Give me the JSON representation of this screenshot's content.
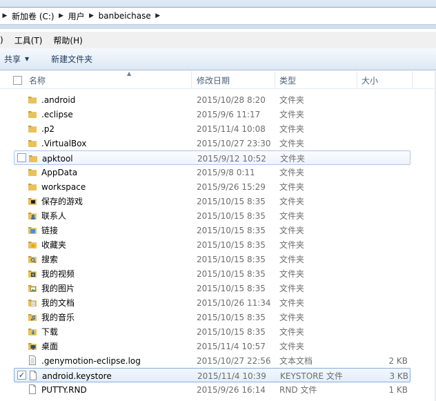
{
  "breadcrumb": {
    "items": [
      "新加卷 (C:)",
      "用户",
      "banbeichase"
    ]
  },
  "menubar": {
    "items": [
      {
        "label": ")",
        "name": "menu-view-partial"
      },
      {
        "label": "工具(T)",
        "name": "menu-tools"
      },
      {
        "label": "帮助(H)",
        "name": "menu-help"
      }
    ]
  },
  "toolbar": {
    "share_label": "共享",
    "new_folder_label": "新建文件夹"
  },
  "columns": {
    "name": "名称",
    "date": "修改日期",
    "type": "类型",
    "size": "大小"
  },
  "files": [
    {
      "name": ".android",
      "date": "2015/10/28 8:20",
      "type": "文件夹",
      "size": "",
      "icon": "folder-icon",
      "state": ""
    },
    {
      "name": ".eclipse",
      "date": "2015/9/6 11:17",
      "type": "文件夹",
      "size": "",
      "icon": "folder-icon",
      "state": ""
    },
    {
      "name": ".p2",
      "date": "2015/11/4 10:08",
      "type": "文件夹",
      "size": "",
      "icon": "folder-icon",
      "state": ""
    },
    {
      "name": ".VirtualBox",
      "date": "2015/10/27 23:30",
      "type": "文件夹",
      "size": "",
      "icon": "folder-icon",
      "state": ""
    },
    {
      "name": "apktool",
      "date": "2015/9/12 10:52",
      "type": "文件夹",
      "size": "",
      "icon": "folder-icon",
      "state": "hot"
    },
    {
      "name": "AppData",
      "date": "2015/9/8 0:11",
      "type": "文件夹",
      "size": "",
      "icon": "folder-icon",
      "state": ""
    },
    {
      "name": "workspace",
      "date": "2015/9/26 15:29",
      "type": "文件夹",
      "size": "",
      "icon": "folder-icon",
      "state": ""
    },
    {
      "name": "保存的游戏",
      "date": "2015/10/15 8:35",
      "type": "文件夹",
      "size": "",
      "icon": "saved-games-folder-icon",
      "state": ""
    },
    {
      "name": "联系人",
      "date": "2015/10/15 8:35",
      "type": "文件夹",
      "size": "",
      "icon": "contacts-folder-icon",
      "state": ""
    },
    {
      "name": "链接",
      "date": "2015/10/15 8:35",
      "type": "文件夹",
      "size": "",
      "icon": "links-folder-icon",
      "state": ""
    },
    {
      "name": "收藏夹",
      "date": "2015/10/15 8:35",
      "type": "文件夹",
      "size": "",
      "icon": "favorites-folder-icon",
      "state": ""
    },
    {
      "name": "搜索",
      "date": "2015/10/15 8:35",
      "type": "文件夹",
      "size": "",
      "icon": "searches-folder-icon",
      "state": ""
    },
    {
      "name": "我的视频",
      "date": "2015/10/15 8:35",
      "type": "文件夹",
      "size": "",
      "icon": "videos-folder-icon",
      "state": ""
    },
    {
      "name": "我的图片",
      "date": "2015/10/15 8:35",
      "type": "文件夹",
      "size": "",
      "icon": "pictures-folder-icon",
      "state": ""
    },
    {
      "name": "我的文档",
      "date": "2015/10/26 11:34",
      "type": "文件夹",
      "size": "",
      "icon": "documents-folder-icon",
      "state": ""
    },
    {
      "name": "我的音乐",
      "date": "2015/10/15 8:35",
      "type": "文件夹",
      "size": "",
      "icon": "music-folder-icon",
      "state": ""
    },
    {
      "name": "下载",
      "date": "2015/10/15 8:35",
      "type": "文件夹",
      "size": "",
      "icon": "downloads-folder-icon",
      "state": ""
    },
    {
      "name": "桌面",
      "date": "2015/11/4 10:57",
      "type": "文件夹",
      "size": "",
      "icon": "desktop-folder-icon",
      "state": ""
    },
    {
      "name": ".genymotion-eclipse.log",
      "date": "2015/10/27 22:56",
      "type": "文本文档",
      "size": "2 KB",
      "icon": "text-file-icon",
      "state": ""
    },
    {
      "name": "android.keystore",
      "date": "2015/11/4 10:39",
      "type": "KEYSTORE 文件",
      "size": "3 KB",
      "icon": "file-icon",
      "state": "selected"
    },
    {
      "name": "PUTTY.RND",
      "date": "2015/9/26 16:14",
      "type": "RND 文件",
      "size": "1 KB",
      "icon": "file-icon",
      "state": ""
    }
  ],
  "colors": {
    "folder": "#e8c25a",
    "folder_dark": "#c99a2e",
    "selection_border": "#84acdd"
  }
}
